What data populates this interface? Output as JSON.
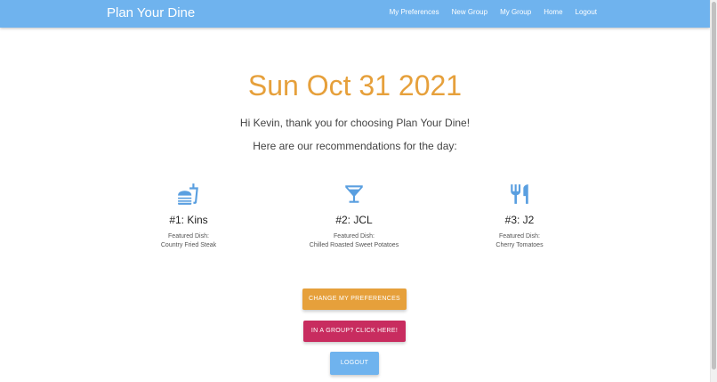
{
  "navbar": {
    "brand": "Plan Your Dine",
    "links": [
      "My Preferences",
      "New Group",
      "My Group",
      "Home",
      "Logout"
    ]
  },
  "main": {
    "date": "Sun Oct 31 2021",
    "greeting": "Hi Kevin, thank you for choosing Plan Your Dine!",
    "subheading": "Here are our recommendations for the day:"
  },
  "recommendations": [
    {
      "icon": "fastfood-icon",
      "title": "#1: Kins",
      "dish_label": "Featured Dish:",
      "dish": "Country Fried Steak"
    },
    {
      "icon": "cocktail-icon",
      "title": "#2: JCL",
      "dish_label": "Featured Dish:",
      "dish": "Chilled Roasted Sweet Potatoes"
    },
    {
      "icon": "restaurant-icon",
      "title": "#3: J2",
      "dish_label": "Featured Dish:",
      "dish": "Cherry Tomatoes"
    }
  ],
  "buttons": {
    "change_prefs": "CHANGE MY PREFERENCES",
    "group": "IN A GROUP? CLICK HERE!",
    "logout": "LOGOUT"
  },
  "colors": {
    "navbar": "#6fb3ee",
    "accent_orange": "#e6a03b",
    "accent_pink": "#c82c5f",
    "icon_blue": "#5a9fe0"
  }
}
